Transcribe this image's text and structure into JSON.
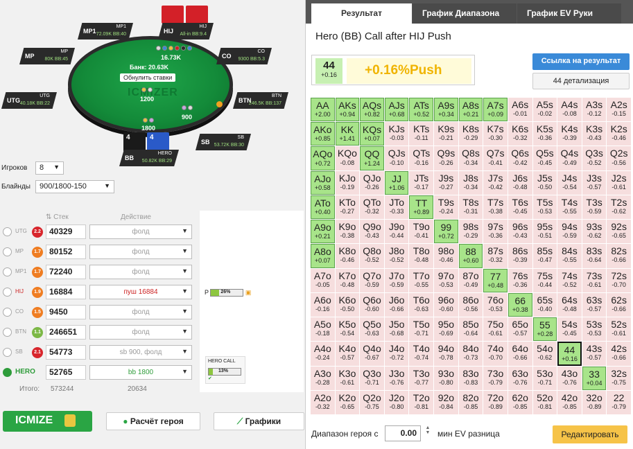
{
  "table": {
    "pot": "Банк: 20.63K",
    "recalc": "Обнулить ставки",
    "watermark": "ICMIZER",
    "center_bet": "1200",
    "btn_bet": "900",
    "sb_bet": "1800",
    "hij_bet": "16.73K",
    "seats": [
      {
        "pos": "MP1",
        "name": "MP1",
        "stack": "72.09K BB:40"
      },
      {
        "pos": "HIJ",
        "name": "HIJ",
        "stack": "All-in BB:9.4"
      },
      {
        "pos": "MP",
        "name": "MP",
        "stack": "80K BB:45"
      },
      {
        "pos": "CO",
        "name": "CO",
        "stack": "9300 BB:5.3"
      },
      {
        "pos": "UTG",
        "name": "UTG",
        "stack": "40.18K BB:22"
      },
      {
        "pos": "BTN",
        "name": "BTN",
        "stack": "246.5K BB:137"
      },
      {
        "pos": "SB",
        "name": "SB",
        "stack": "53.72K BB:30"
      },
      {
        "pos": "BB",
        "name": "HERO",
        "stack": "50.82K BB:29"
      }
    ],
    "hero_cards": [
      "4",
      "4"
    ]
  },
  "settings": {
    "players_label": "Игроков",
    "players": "8",
    "blinds_label": "Блайнды",
    "blinds": "900/1800-150"
  },
  "columns": {
    "stack": "Стек",
    "action": "Действие"
  },
  "players": [
    {
      "name": "UTG",
      "badge": "2.2",
      "color": "#d8262c",
      "stack": "40329",
      "action": "фолд"
    },
    {
      "name": "MP",
      "badge": "1.7",
      "color": "#ef7d22",
      "stack": "80152",
      "action": "фолд"
    },
    {
      "name": "MP1",
      "badge": "1.7",
      "color": "#ef7d22",
      "stack": "72240",
      "action": "фолд"
    },
    {
      "name": "HIJ",
      "badge": "1.9",
      "color": "#ef7d22",
      "stack": "16884",
      "action": "пуш 16884"
    },
    {
      "name": "CO",
      "badge": "1.5",
      "color": "#ef7d22",
      "stack": "9450",
      "action": "фолд"
    },
    {
      "name": "BTN",
      "badge": "1.1",
      "color": "#7cb846",
      "stack": "246651",
      "action": "фолд"
    },
    {
      "name": "SB",
      "badge": "2.1",
      "color": "#d8262c",
      "stack": "54773",
      "action": "sb 900, фолд"
    },
    {
      "name": "HERO",
      "badge": "",
      "color": "#2e9c3a",
      "stack": "52765",
      "action": "bb 1800"
    }
  ],
  "totals": {
    "label": "Итого:",
    "stack": "573244",
    "action": "20634"
  },
  "range_bar": {
    "label": "P",
    "value": "26%",
    "pct": 26
  },
  "hero_call": {
    "label": "HERO CALL",
    "value": "13%",
    "pct": 13
  },
  "buttons": {
    "icmize": "ICMIZE",
    "hero_calc": "Расчёт героя",
    "graphs": "Графики"
  },
  "right": {
    "tabs": [
      "Результат",
      "График Диапазона",
      "График EV Руки"
    ],
    "title": "Hero (BB) Call after HIJ Push",
    "hand": "44",
    "hand_ev": "+0.16",
    "result": "+0.16%Push",
    "link_btn": "Ссылка на результат",
    "detail_btn": "44 детализация",
    "footer_label": "Диапазон героя с",
    "threshold": "0.00",
    "footer_suffix": "мин EV разница",
    "edit_btn": "Редактировать"
  },
  "grid": [
    [
      "AA",
      "+2.00"
    ],
    [
      "AKs",
      "+0.94"
    ],
    [
      "AQs",
      "+0.82"
    ],
    [
      "AJs",
      "+0.68"
    ],
    [
      "ATs",
      "+0.52"
    ],
    [
      "A9s",
      "+0.34"
    ],
    [
      "A8s",
      "+0.21"
    ],
    [
      "A7s",
      "+0.09"
    ],
    [
      "A6s",
      "-0.01"
    ],
    [
      "A5s",
      "-0.02"
    ],
    [
      "A4s",
      "-0.08"
    ],
    [
      "A3s",
      "-0.12"
    ],
    [
      "A2s",
      "-0.15"
    ],
    [
      "AKo",
      "+0.85"
    ],
    [
      "KK",
      "+1.41"
    ],
    [
      "KQs",
      "+0.07"
    ],
    [
      "KJs",
      "-0.03"
    ],
    [
      "KTs",
      "-0.11"
    ],
    [
      "K9s",
      "-0.21"
    ],
    [
      "K8s",
      "-0.29"
    ],
    [
      "K7s",
      "-0.30"
    ],
    [
      "K6s",
      "-0.32"
    ],
    [
      "K5s",
      "-0.36"
    ],
    [
      "K4s",
      "-0.39"
    ],
    [
      "K3s",
      "-0.43"
    ],
    [
      "K2s",
      "-0.46"
    ],
    [
      "AQo",
      "+0.72"
    ],
    [
      "KQo",
      "-0.08"
    ],
    [
      "QQ",
      "+1.24"
    ],
    [
      "QJs",
      "-0.10"
    ],
    [
      "QTs",
      "-0.16"
    ],
    [
      "Q9s",
      "-0.26"
    ],
    [
      "Q8s",
      "-0.34"
    ],
    [
      "Q7s",
      "-0.41"
    ],
    [
      "Q6s",
      "-0.42"
    ],
    [
      "Q5s",
      "-0.45"
    ],
    [
      "Q4s",
      "-0.49"
    ],
    [
      "Q3s",
      "-0.52"
    ],
    [
      "Q2s",
      "-0.56"
    ],
    [
      "AJo",
      "+0.58"
    ],
    [
      "KJo",
      "-0.19"
    ],
    [
      "QJo",
      "-0.26"
    ],
    [
      "JJ",
      "+1.06"
    ],
    [
      "JTs",
      "-0.17"
    ],
    [
      "J9s",
      "-0.27"
    ],
    [
      "J8s",
      "-0.34"
    ],
    [
      "J7s",
      "-0.42"
    ],
    [
      "J6s",
      "-0.48"
    ],
    [
      "J5s",
      "-0.50"
    ],
    [
      "J4s",
      "-0.54"
    ],
    [
      "J3s",
      "-0.57"
    ],
    [
      "J2s",
      "-0.61"
    ],
    [
      "ATo",
      "+0.40"
    ],
    [
      "KTo",
      "-0.27"
    ],
    [
      "QTo",
      "-0.32"
    ],
    [
      "JTo",
      "-0.33"
    ],
    [
      "TT",
      "+0.89"
    ],
    [
      "T9s",
      "-0.24"
    ],
    [
      "T8s",
      "-0.31"
    ],
    [
      "T7s",
      "-0.38"
    ],
    [
      "T6s",
      "-0.45"
    ],
    [
      "T5s",
      "-0.53"
    ],
    [
      "T4s",
      "-0.55"
    ],
    [
      "T3s",
      "-0.59"
    ],
    [
      "T2s",
      "-0.62"
    ],
    [
      "A9o",
      "+0.21"
    ],
    [
      "K9o",
      "-0.38"
    ],
    [
      "Q9o",
      "-0.43"
    ],
    [
      "J9o",
      "-0.44"
    ],
    [
      "T9o",
      "-0.41"
    ],
    [
      "99",
      "+0.72"
    ],
    [
      "98s",
      "-0.29"
    ],
    [
      "97s",
      "-0.36"
    ],
    [
      "96s",
      "-0.43"
    ],
    [
      "95s",
      "-0.51"
    ],
    [
      "94s",
      "-0.59"
    ],
    [
      "93s",
      "-0.62"
    ],
    [
      "92s",
      "-0.65"
    ],
    [
      "A8o",
      "+0.07"
    ],
    [
      "K8o",
      "-0.46"
    ],
    [
      "Q8o",
      "-0.52"
    ],
    [
      "J8o",
      "-0.52"
    ],
    [
      "T8o",
      "-0.48"
    ],
    [
      "98o",
      "-0.46"
    ],
    [
      "88",
      "+0.60"
    ],
    [
      "87s",
      "-0.32"
    ],
    [
      "86s",
      "-0.39"
    ],
    [
      "85s",
      "-0.47"
    ],
    [
      "84s",
      "-0.55"
    ],
    [
      "83s",
      "-0.64"
    ],
    [
      "82s",
      "-0.66"
    ],
    [
      "A7o",
      "-0.05"
    ],
    [
      "K7o",
      "-0.48"
    ],
    [
      "Q7o",
      "-0.59"
    ],
    [
      "J7o",
      "-0.59"
    ],
    [
      "T7o",
      "-0.55"
    ],
    [
      "97o",
      "-0.53"
    ],
    [
      "87o",
      "-0.49"
    ],
    [
      "77",
      "+0.48"
    ],
    [
      "76s",
      "-0.36"
    ],
    [
      "75s",
      "-0.44"
    ],
    [
      "74s",
      "-0.52"
    ],
    [
      "73s",
      "-0.61"
    ],
    [
      "72s",
      "-0.70"
    ],
    [
      "A6o",
      "-0.16"
    ],
    [
      "K6o",
      "-0.50"
    ],
    [
      "Q6o",
      "-0.60"
    ],
    [
      "J6o",
      "-0.66"
    ],
    [
      "T6o",
      "-0.63"
    ],
    [
      "96o",
      "-0.60"
    ],
    [
      "86o",
      "-0.56"
    ],
    [
      "76o",
      "-0.53"
    ],
    [
      "66",
      "+0.38"
    ],
    [
      "65s",
      "-0.40"
    ],
    [
      "64s",
      "-0.48"
    ],
    [
      "63s",
      "-0.57"
    ],
    [
      "62s",
      "-0.66"
    ],
    [
      "A5o",
      "-0.18"
    ],
    [
      "K5o",
      "-0.54"
    ],
    [
      "Q5o",
      "-0.63"
    ],
    [
      "J5o",
      "-0.68"
    ],
    [
      "T5o",
      "-0.71"
    ],
    [
      "95o",
      "-0.69"
    ],
    [
      "85o",
      "-0.64"
    ],
    [
      "75o",
      "-0.61"
    ],
    [
      "65o",
      "-0.57"
    ],
    [
      "55",
      "+0.28"
    ],
    [
      "54s",
      "-0.45"
    ],
    [
      "53s",
      "-0.53"
    ],
    [
      "52s",
      "-0.61"
    ],
    [
      "A4o",
      "-0.24"
    ],
    [
      "K4o",
      "-0.57"
    ],
    [
      "Q4o",
      "-0.67"
    ],
    [
      "J4o",
      "-0.72"
    ],
    [
      "T4o",
      "-0.74"
    ],
    [
      "94o",
      "-0.78"
    ],
    [
      "84o",
      "-0.73"
    ],
    [
      "74o",
      "-0.70"
    ],
    [
      "64o",
      "-0.66"
    ],
    [
      "54o",
      "-0.62"
    ],
    [
      "44",
      "+0.16"
    ],
    [
      "43s",
      "-0.57"
    ],
    [
      "42s",
      "-0.66"
    ],
    [
      "A3o",
      "-0.28"
    ],
    [
      "K3o",
      "-0.61"
    ],
    [
      "Q3o",
      "-0.71"
    ],
    [
      "J3o",
      "-0.76"
    ],
    [
      "T3o",
      "-0.77"
    ],
    [
      "93o",
      "-0.80"
    ],
    [
      "83o",
      "-0.83"
    ],
    [
      "73o",
      "-0.79"
    ],
    [
      "63o",
      "-0.76"
    ],
    [
      "53o",
      "-0.71"
    ],
    [
      "43o",
      "-0.76"
    ],
    [
      "33",
      "+0.04"
    ],
    [
      "32s",
      "-0.75"
    ],
    [
      "A2o",
      "-0.32"
    ],
    [
      "K2o",
      "-0.65"
    ],
    [
      "Q2o",
      "-0.75"
    ],
    [
      "J2o",
      "-0.80"
    ],
    [
      "T2o",
      "-0.81"
    ],
    [
      "92o",
      "-0.84"
    ],
    [
      "82o",
      "-0.85"
    ],
    [
      "72o",
      "-0.89"
    ],
    [
      "62o",
      "-0.85"
    ],
    [
      "52o",
      "-0.81"
    ],
    [
      "42o",
      "-0.85"
    ],
    [
      "32o",
      "-0.89"
    ],
    [
      "22",
      "-0.79"
    ]
  ]
}
